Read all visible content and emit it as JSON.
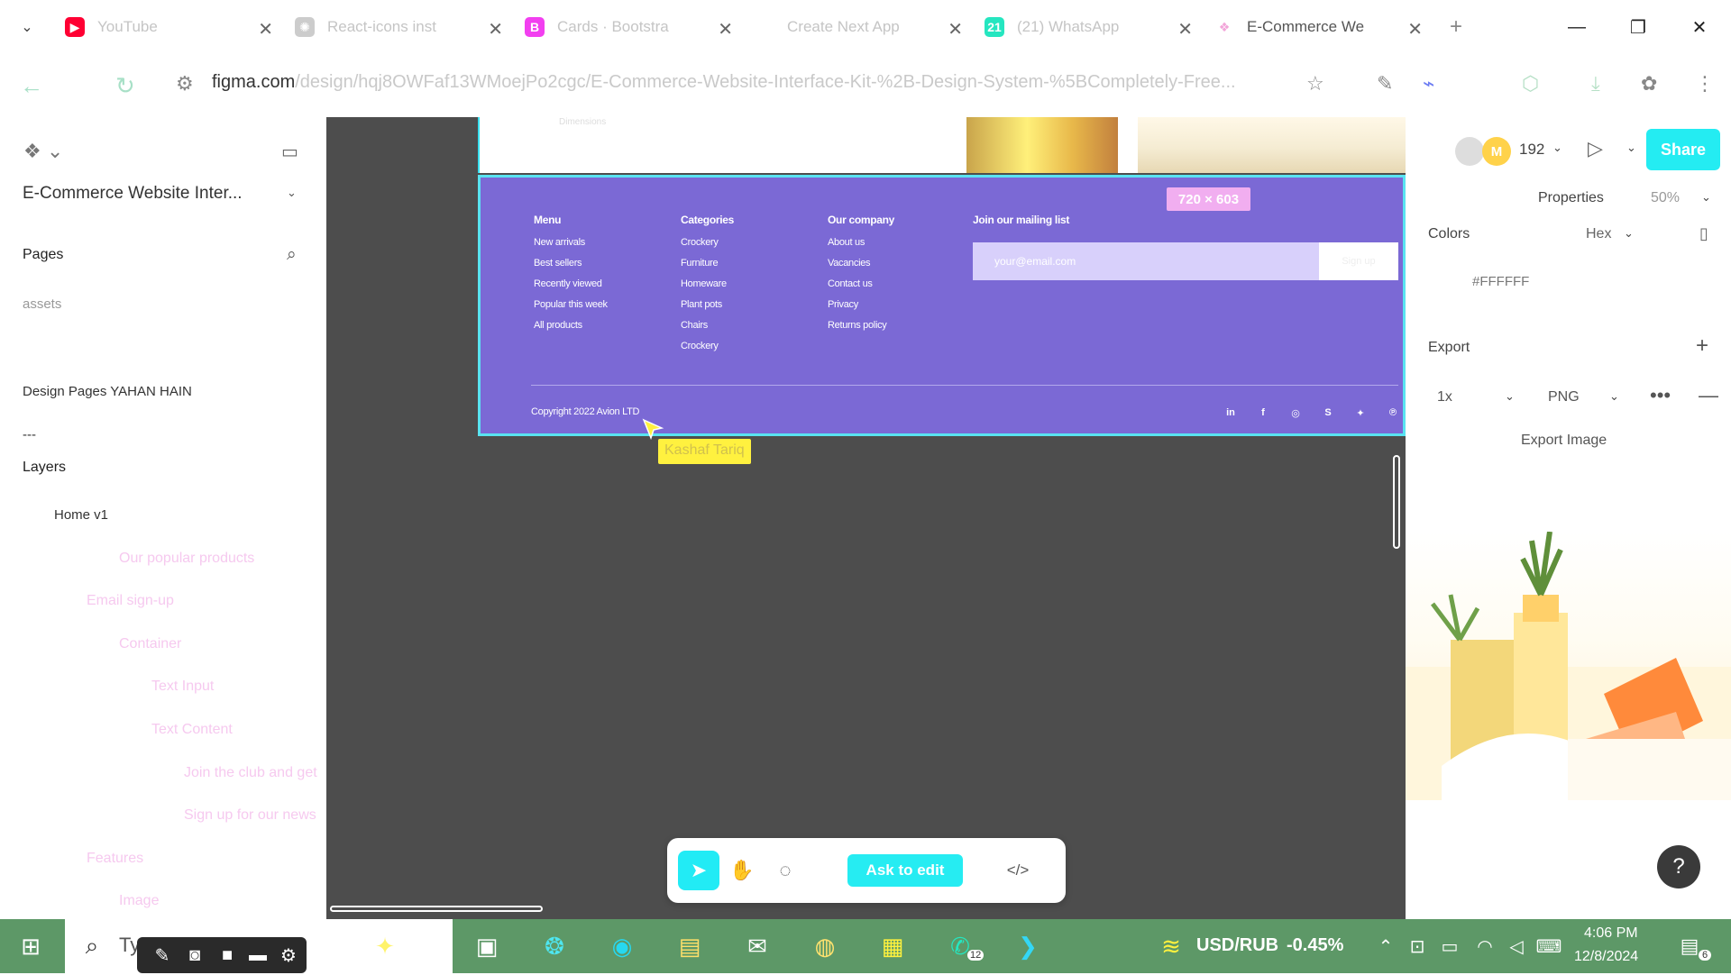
{
  "browser": {
    "tabs": [
      {
        "label": "YouTube",
        "favicon": "youtube-icon",
        "color": "#ff0033",
        "glyph": "▶",
        "active": false
      },
      {
        "label": "React-icons inst",
        "favicon": "openai-icon",
        "color": "#cccccc",
        "glyph": "✺",
        "active": false
      },
      {
        "label": "Cards · Bootstra",
        "favicon": "bootstrap-icon",
        "color": "#f23ff0",
        "glyph": "B",
        "active": false
      },
      {
        "label": "Create Next App",
        "favicon": "nextjs-icon",
        "color": "#ffffff",
        "glyph": "",
        "active": false
      },
      {
        "label": "(21) WhatsApp",
        "favicon": "whatsapp-icon",
        "color": "#25e6c0",
        "glyph": "21",
        "active": false
      },
      {
        "label": "E-Commerce We",
        "favicon": "figma-icon",
        "color": "#ffffff",
        "glyph": "❖",
        "active": true
      }
    ],
    "url_host": "figma.com",
    "url_path": "/design/hqj8OWFaf13WMoejPo2cgc/E-Commerce-Website-Interface-Kit-%2B-Design-System-%5BCompletely-Free..."
  },
  "left_panel": {
    "file_name": "E-Commerce Website Inter...",
    "pages_heading": "Pages",
    "pages": [
      "assets",
      "Design Pages YAHAN HAIN",
      "---"
    ],
    "layers_heading": "Layers",
    "layers": [
      {
        "label": "Home v1",
        "depth": 0,
        "faint": false
      },
      {
        "label": "Our popular products",
        "depth": 2,
        "faint": true
      },
      {
        "label": "Email sign-up",
        "depth": 1,
        "faint": true
      },
      {
        "label": "Container",
        "depth": 2,
        "faint": true
      },
      {
        "label": "Text Input",
        "depth": 3,
        "faint": true
      },
      {
        "label": "Text Content",
        "depth": 3,
        "faint": true
      },
      {
        "label": "Join the club and get",
        "depth": 4,
        "faint": true
      },
      {
        "label": "Sign up for our news",
        "depth": 4,
        "faint": true
      },
      {
        "label": "Features",
        "depth": 1,
        "faint": true
      },
      {
        "label": "Image",
        "depth": 2,
        "faint": true
      }
    ]
  },
  "canvas": {
    "frame_top_caption": "Dimensions",
    "size_badge": "720 × 603",
    "footer": {
      "columns": [
        {
          "heading": "Menu",
          "items": [
            "New arrivals",
            "Best sellers",
            "Recently viewed",
            "Popular this week",
            "All products"
          ]
        },
        {
          "heading": "Categories",
          "items": [
            "Crockery",
            "Furniture",
            "Homeware",
            "Plant pots",
            "Chairs",
            "Crockery"
          ]
        },
        {
          "heading": "Our company",
          "items": [
            "About us",
            "Vacancies",
            "Contact us",
            "Privacy",
            "Returns policy"
          ]
        }
      ],
      "mailing_heading": "Join our mailing list",
      "email_placeholder": "your@email.com",
      "signup_button": "Sign up",
      "copyright": "Copyright 2022 Avion LTD",
      "social_icons": [
        "linkedin-icon",
        "facebook-icon",
        "instagram-icon",
        "skype-icon",
        "twitter-icon",
        "pinterest-icon"
      ]
    },
    "collaborator_cursor": "Kashaf Tariq",
    "bottom_toolbar": {
      "ask_to_edit": "Ask to edit",
      "tools": [
        "move-tool-icon",
        "hand-tool-icon",
        "comment-tool-icon",
        "dev-mode-icon"
      ]
    }
  },
  "right_panel": {
    "avatar_initial": "M",
    "viewer_count": "192",
    "share_label": "Share",
    "properties_label": "Properties",
    "zoom": "50%",
    "colors_heading": "Colors",
    "color_format": "Hex",
    "color_value": "#FFFFFF",
    "export_heading": "Export",
    "export_scale": "1x",
    "export_format": "PNG",
    "export_button": "Export Image",
    "help_label": "?"
  },
  "taskbar": {
    "search_placeholder": "Ty",
    "currency_pair": "USD/RUB",
    "currency_change": "-0.45%",
    "time": "4:06 PM",
    "date": "12/8/2024",
    "notification_count": "6",
    "whatsapp_badge": "12"
  },
  "colors": {
    "accent": "#24ecf2",
    "footer_bg": "#7b69d5",
    "canvas_bg": "#4d4d4d",
    "taskbar_bg": "#5d9867"
  }
}
